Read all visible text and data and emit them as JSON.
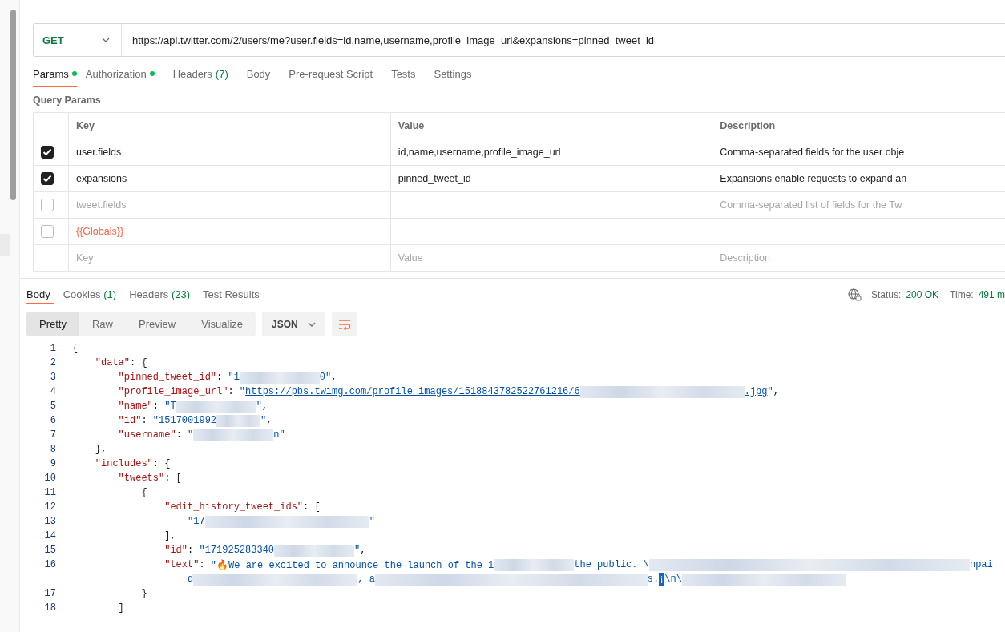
{
  "request": {
    "method": "GET",
    "url": "https://api.twitter.com/2/users/me?user.fields=id,name,username,profile_image_url&expansions=pinned_tweet_id"
  },
  "request_tabs": [
    {
      "label": "Params",
      "dot": true,
      "selected": true
    },
    {
      "label": "Authorization",
      "dot": true,
      "selected": false
    },
    {
      "label": "Headers",
      "count": "(7)",
      "dot": false,
      "selected": false
    },
    {
      "label": "Body",
      "dot": false,
      "selected": false
    },
    {
      "label": "Pre-request Script",
      "dot": false,
      "selected": false
    },
    {
      "label": "Tests",
      "dot": false,
      "selected": false
    },
    {
      "label": "Settings",
      "dot": false,
      "selected": false
    }
  ],
  "query_params": {
    "title": "Query Params",
    "columns": [
      "Key",
      "Value",
      "Description"
    ],
    "rows": [
      {
        "kind": "param",
        "checked": true,
        "key": "user.fields",
        "value": "id,name,username,profile_image_url",
        "description": "Comma-separated fields for the user obje"
      },
      {
        "kind": "param",
        "checked": true,
        "key": "expansions",
        "value": "pinned_tweet_id",
        "description": "Expansions enable requests to expand an"
      },
      {
        "kind": "param",
        "checked": false,
        "key": "tweet.fields",
        "description": "Comma-separated list of fields for the Tw"
      },
      {
        "kind": "variable",
        "checked": false,
        "key": "{{Globals}}"
      },
      {
        "kind": "new",
        "key": "Key",
        "value": "Value",
        "description": "Description"
      }
    ]
  },
  "response_tabs": [
    {
      "label": "Body",
      "selected": true
    },
    {
      "label": "Cookies",
      "count": "(1)",
      "selected": false
    },
    {
      "label": "Headers",
      "count": "(23)",
      "selected": false
    },
    {
      "label": "Test Results",
      "selected": false
    }
  ],
  "response_status": {
    "status_label": "Status:",
    "status": "200 OK",
    "time_label": "Time:",
    "time": "491 m"
  },
  "view_modes": [
    {
      "label": "Pretty",
      "selected": true
    },
    {
      "label": "Raw",
      "selected": false
    },
    {
      "label": "Preview",
      "selected": false
    },
    {
      "label": "Visualize",
      "selected": false
    }
  ],
  "format": "JSON",
  "code": [
    {
      "n": "1",
      "segs": [
        {
          "kind": "punct",
          "t": "{"
        }
      ]
    },
    {
      "n": "2",
      "segs": [
        {
          "kind": "key",
          "t": "    \"data\""
        },
        {
          "kind": "punct",
          "t": ": {"
        }
      ]
    },
    {
      "n": "3",
      "segs": [
        {
          "kind": "key",
          "t": "        \"pinned_tweet_id\""
        },
        {
          "kind": "punct",
          "t": ": "
        },
        {
          "kind": "str",
          "t": "\"1"
        },
        {
          "kind": "blur"
        },
        {
          "kind": "str",
          "t": "0\""
        },
        {
          "kind": "punct",
          "t": ","
        }
      ]
    },
    {
      "n": "4",
      "segs": [
        {
          "kind": "key",
          "t": "        \"profile_image_url\""
        },
        {
          "kind": "punct",
          "t": ": "
        },
        {
          "kind": "str",
          "t": "\""
        },
        {
          "kind": "link",
          "t": "https://pbs.twimg.com/profile_images/1518843782522761216/6"
        },
        {
          "kind": "longblur"
        },
        {
          "kind": "link",
          "t": ".jpg"
        },
        {
          "kind": "str",
          "t": "\""
        },
        {
          "kind": "punct",
          "t": ","
        }
      ]
    },
    {
      "n": "5",
      "segs": [
        {
          "kind": "key",
          "t": "        \"name\""
        },
        {
          "kind": "punct",
          "t": ": "
        },
        {
          "kind": "str",
          "t": "\"T"
        },
        {
          "kind": "blur"
        },
        {
          "kind": "str",
          "t": "\""
        },
        {
          "kind": "punct",
          "t": ","
        }
      ]
    },
    {
      "n": "6",
      "segs": [
        {
          "kind": "key",
          "t": "        \"id\""
        },
        {
          "kind": "punct",
          "t": ": "
        },
        {
          "kind": "str",
          "t": "\"1517001992"
        },
        {
          "kind": "shortblur"
        },
        {
          "kind": "str",
          "t": "\""
        },
        {
          "kind": "punct",
          "t": ","
        }
      ]
    },
    {
      "n": "7",
      "segs": [
        {
          "kind": "key",
          "t": "        \"username\""
        },
        {
          "kind": "punct",
          "t": ": "
        },
        {
          "kind": "str",
          "t": "\""
        },
        {
          "kind": "blur"
        },
        {
          "kind": "str",
          "t": "n\""
        }
      ]
    },
    {
      "n": "8",
      "segs": [
        {
          "kind": "punct",
          "t": "    },"
        }
      ]
    },
    {
      "n": "9",
      "segs": [
        {
          "kind": "key",
          "t": "    \"includes\""
        },
        {
          "kind": "punct",
          "t": ": {"
        }
      ]
    },
    {
      "n": "10",
      "segs": [
        {
          "kind": "key",
          "t": "        \"tweets\""
        },
        {
          "kind": "punct",
          "t": ": ["
        }
      ]
    },
    {
      "n": "11",
      "segs": [
        {
          "kind": "punct",
          "t": "            {"
        }
      ]
    },
    {
      "n": "12",
      "segs": [
        {
          "kind": "key",
          "t": "                \"edit_history_tweet_ids\""
        },
        {
          "kind": "punct",
          "t": ": ["
        }
      ]
    },
    {
      "n": "13",
      "segs": [
        {
          "kind": "str",
          "t": "                    \"17"
        },
        {
          "kind": "longblur"
        },
        {
          "kind": "str",
          "t": "\""
        }
      ]
    },
    {
      "n": "14",
      "segs": [
        {
          "kind": "punct",
          "t": "                ],"
        }
      ]
    },
    {
      "n": "15",
      "segs": [
        {
          "kind": "key",
          "t": "                \"id\""
        },
        {
          "kind": "punct",
          "t": ": "
        },
        {
          "kind": "str",
          "t": "\"171925283340"
        },
        {
          "kind": "blur"
        },
        {
          "kind": "str",
          "t": "\""
        },
        {
          "kind": "punct",
          "t": ","
        }
      ]
    },
    {
      "n": "16",
      "segs": [
        {
          "kind": "key",
          "t": "                \"text\""
        },
        {
          "kind": "punct",
          "t": ": "
        },
        {
          "kind": "str",
          "t": "\"🔥We are excited to announce the launch of the 1"
        },
        {
          "kind": "blur"
        },
        {
          "kind": "str",
          "t": "the public. \\"
        },
        {
          "kind": "hugeblur"
        },
        {
          "kind": "str",
          "t": "npai"
        }
      ],
      "cont": [
        {
          "kind": "str",
          "t": "                    d"
        },
        {
          "kind": "longblur"
        },
        {
          "kind": "str",
          "t": ", a"
        },
        {
          "kind": "wideblur"
        },
        {
          "kind": "str",
          "t": "s."
        },
        {
          "kind": "info",
          "t": "ℹ"
        },
        {
          "kind": "str",
          "t": "\\n\\"
        },
        {
          "kind": "longblur"
        }
      ]
    },
    {
      "n": "17",
      "segs": [
        {
          "kind": "punct",
          "t": "            }"
        }
      ]
    },
    {
      "n": "18",
      "segs": [
        {
          "kind": "punct",
          "t": "        ]"
        }
      ]
    }
  ]
}
